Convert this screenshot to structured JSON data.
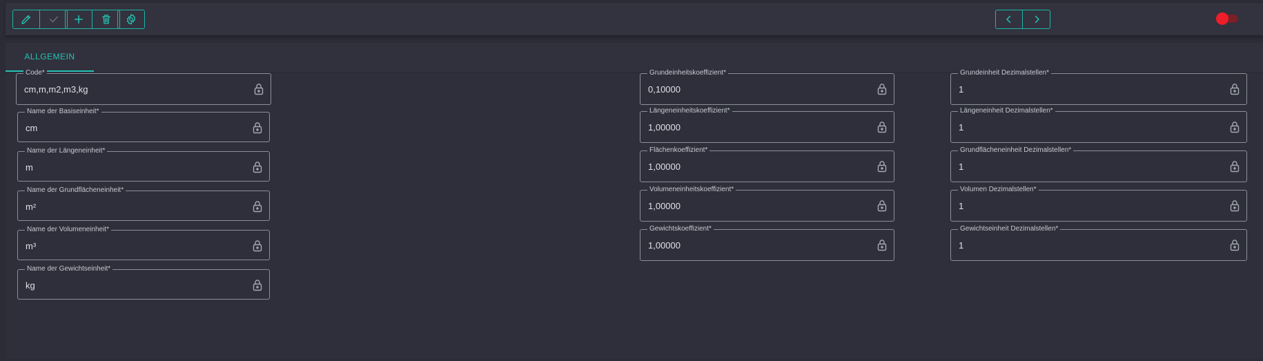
{
  "toolbar": {
    "buttons": [
      {
        "name": "edit",
        "icon": "pencil-icon"
      },
      {
        "name": "confirm",
        "icon": "check-icon"
      },
      {
        "name": "add",
        "icon": "plus-icon"
      },
      {
        "name": "delete",
        "icon": "trash-icon"
      },
      {
        "name": "settings",
        "icon": "gear-icon"
      },
      {
        "name": "previous",
        "icon": "chevron-left-icon"
      },
      {
        "name": "next",
        "icon": "chevron-right-icon"
      }
    ],
    "toggle": {
      "state": "off",
      "color": "#ee1d2a"
    }
  },
  "tabs": [
    {
      "label": "ALLGEMEIN",
      "active": true
    }
  ],
  "colors": {
    "accent": "#25c2b5",
    "background": "#2b2c36"
  },
  "form": {
    "code": {
      "label": "Code*",
      "value": "cm,m,m2,m3,kg"
    },
    "base_unit_name": {
      "label": "Name der Basiseinheit*",
      "value": "cm"
    },
    "length_unit_name": {
      "label": "Name der Längeneinheit*",
      "value": "m"
    },
    "area_unit_name": {
      "label": "Name der Grundflächeneinheit*",
      "value": "m²"
    },
    "volume_unit_name": {
      "label": "Name der Volumeneinheit*",
      "value": "m³"
    },
    "weight_unit_name": {
      "label": "Name der Gewichtseinheit*",
      "value": "kg"
    },
    "base_coefficient": {
      "label": "Grundeinheitskoeffizient*",
      "value": "0,10000"
    },
    "length_coefficient": {
      "label": "Längeneinheitskoeffizient*",
      "value": "1,00000"
    },
    "area_coefficient": {
      "label": "Flächenkoeffizient*",
      "value": "1,00000"
    },
    "volume_coefficient": {
      "label": "Volumeneinheitskoeffizient*",
      "value": "1,00000"
    },
    "weight_coefficient": {
      "label": "Gewichtskoeffizient*",
      "value": "1,00000"
    },
    "base_decimals": {
      "label": "Grundeinheit Dezimalstellen*",
      "value": "1"
    },
    "length_decimals": {
      "label": "Längeneinheit Dezimalstellen*",
      "value": "1"
    },
    "area_decimals": {
      "label": "Grundflächeneinheit Dezimalstellen*",
      "value": "1"
    },
    "volume_decimals": {
      "label": "Volumen Dezimalstellen*",
      "value": "1"
    },
    "weight_decimals": {
      "label": "Gewichtseinheit Dezimalstellen*",
      "value": "1"
    }
  }
}
